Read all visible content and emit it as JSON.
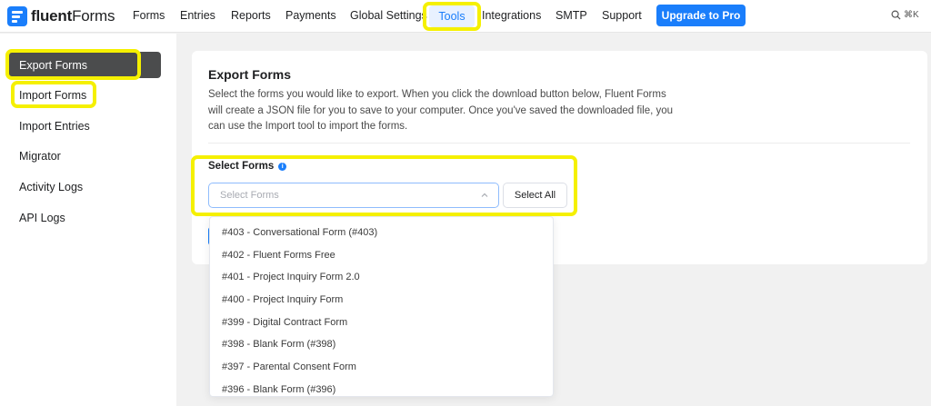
{
  "app": {
    "logo_text_bold": "fluent",
    "logo_text_rest": "Forms"
  },
  "nav": {
    "items": [
      "Forms",
      "Entries",
      "Reports",
      "Payments",
      "Global Settings"
    ],
    "active": "Tools",
    "after": [
      "Integrations",
      "SMTP",
      "Support"
    ],
    "upgrade": "Upgrade to Pro",
    "shortcut": "⌘K"
  },
  "sidebar": {
    "active": "Export Forms",
    "items": [
      "Import Forms",
      "Import Entries",
      "Migrator",
      "Activity Logs",
      "API Logs"
    ]
  },
  "card": {
    "title": "Export Forms",
    "description": "Select the forms you would like to export. When you click the download button below, Fluent Forms will create a JSON file for you to save to your computer. Once you've saved the downloaded file, you can use the Import tool to import the forms.",
    "select_label": "Select Forms",
    "select_placeholder": "Select Forms",
    "select_all": "Select All"
  },
  "dropdown": {
    "options": [
      "#403 - Conversational Form (#403)",
      "#402 - Fluent Forms Free",
      "#401 - Project Inquiry Form 2.0",
      "#400 - Project Inquiry Form",
      "#399 - Digital Contract Form",
      "#398 - Blank Form (#398)",
      "#397 - Parental Consent Form",
      "#396 - Blank Form (#396)"
    ]
  },
  "colors": {
    "primary": "#1a7efb",
    "highlight": "#f5f000",
    "sidebar_active": "#4b4c4d"
  }
}
